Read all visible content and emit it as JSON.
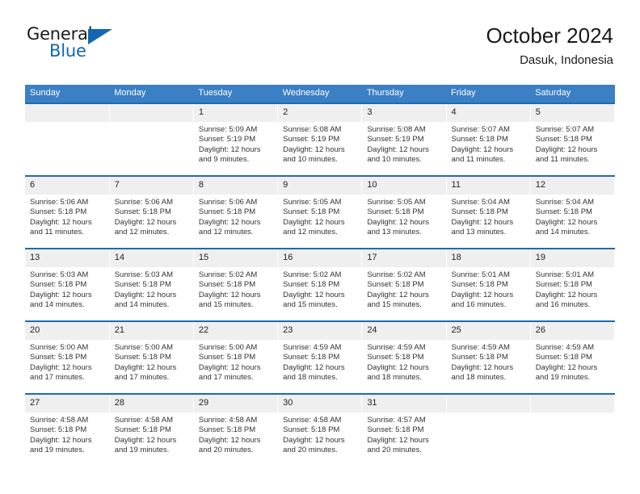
{
  "brand": {
    "line1": "General",
    "line2": "Blue",
    "logo_icon": "triangle-logo-icon",
    "accent_color": "#1267b2"
  },
  "header": {
    "title": "October 2024",
    "subtitle": "Dasuk, Indonesia"
  },
  "calendar": {
    "header_bg": "#3b7fc4",
    "cell_top_border": "#1f6cb0",
    "daynum_bg": "#efefef",
    "weekdays": [
      "Sunday",
      "Monday",
      "Tuesday",
      "Wednesday",
      "Thursday",
      "Friday",
      "Saturday"
    ],
    "weeks": [
      [
        {
          "day": "",
          "sunrise": "",
          "sunset": "",
          "daylight1": "",
          "daylight2": ""
        },
        {
          "day": "",
          "sunrise": "",
          "sunset": "",
          "daylight1": "",
          "daylight2": ""
        },
        {
          "day": "1",
          "sunrise": "Sunrise: 5:09 AM",
          "sunset": "Sunset: 5:19 PM",
          "daylight1": "Daylight: 12 hours",
          "daylight2": "and 9 minutes."
        },
        {
          "day": "2",
          "sunrise": "Sunrise: 5:08 AM",
          "sunset": "Sunset: 5:19 PM",
          "daylight1": "Daylight: 12 hours",
          "daylight2": "and 10 minutes."
        },
        {
          "day": "3",
          "sunrise": "Sunrise: 5:08 AM",
          "sunset": "Sunset: 5:19 PM",
          "daylight1": "Daylight: 12 hours",
          "daylight2": "and 10 minutes."
        },
        {
          "day": "4",
          "sunrise": "Sunrise: 5:07 AM",
          "sunset": "Sunset: 5:18 PM",
          "daylight1": "Daylight: 12 hours",
          "daylight2": "and 11 minutes."
        },
        {
          "day": "5",
          "sunrise": "Sunrise: 5:07 AM",
          "sunset": "Sunset: 5:18 PM",
          "daylight1": "Daylight: 12 hours",
          "daylight2": "and 11 minutes."
        }
      ],
      [
        {
          "day": "6",
          "sunrise": "Sunrise: 5:06 AM",
          "sunset": "Sunset: 5:18 PM",
          "daylight1": "Daylight: 12 hours",
          "daylight2": "and 11 minutes."
        },
        {
          "day": "7",
          "sunrise": "Sunrise: 5:06 AM",
          "sunset": "Sunset: 5:18 PM",
          "daylight1": "Daylight: 12 hours",
          "daylight2": "and 12 minutes."
        },
        {
          "day": "8",
          "sunrise": "Sunrise: 5:06 AM",
          "sunset": "Sunset: 5:18 PM",
          "daylight1": "Daylight: 12 hours",
          "daylight2": "and 12 minutes."
        },
        {
          "day": "9",
          "sunrise": "Sunrise: 5:05 AM",
          "sunset": "Sunset: 5:18 PM",
          "daylight1": "Daylight: 12 hours",
          "daylight2": "and 12 minutes."
        },
        {
          "day": "10",
          "sunrise": "Sunrise: 5:05 AM",
          "sunset": "Sunset: 5:18 PM",
          "daylight1": "Daylight: 12 hours",
          "daylight2": "and 13 minutes."
        },
        {
          "day": "11",
          "sunrise": "Sunrise: 5:04 AM",
          "sunset": "Sunset: 5:18 PM",
          "daylight1": "Daylight: 12 hours",
          "daylight2": "and 13 minutes."
        },
        {
          "day": "12",
          "sunrise": "Sunrise: 5:04 AM",
          "sunset": "Sunset: 5:18 PM",
          "daylight1": "Daylight: 12 hours",
          "daylight2": "and 14 minutes."
        }
      ],
      [
        {
          "day": "13",
          "sunrise": "Sunrise: 5:03 AM",
          "sunset": "Sunset: 5:18 PM",
          "daylight1": "Daylight: 12 hours",
          "daylight2": "and 14 minutes."
        },
        {
          "day": "14",
          "sunrise": "Sunrise: 5:03 AM",
          "sunset": "Sunset: 5:18 PM",
          "daylight1": "Daylight: 12 hours",
          "daylight2": "and 14 minutes."
        },
        {
          "day": "15",
          "sunrise": "Sunrise: 5:02 AM",
          "sunset": "Sunset: 5:18 PM",
          "daylight1": "Daylight: 12 hours",
          "daylight2": "and 15 minutes."
        },
        {
          "day": "16",
          "sunrise": "Sunrise: 5:02 AM",
          "sunset": "Sunset: 5:18 PM",
          "daylight1": "Daylight: 12 hours",
          "daylight2": "and 15 minutes."
        },
        {
          "day": "17",
          "sunrise": "Sunrise: 5:02 AM",
          "sunset": "Sunset: 5:18 PM",
          "daylight1": "Daylight: 12 hours",
          "daylight2": "and 15 minutes."
        },
        {
          "day": "18",
          "sunrise": "Sunrise: 5:01 AM",
          "sunset": "Sunset: 5:18 PM",
          "daylight1": "Daylight: 12 hours",
          "daylight2": "and 16 minutes."
        },
        {
          "day": "19",
          "sunrise": "Sunrise: 5:01 AM",
          "sunset": "Sunset: 5:18 PM",
          "daylight1": "Daylight: 12 hours",
          "daylight2": "and 16 minutes."
        }
      ],
      [
        {
          "day": "20",
          "sunrise": "Sunrise: 5:00 AM",
          "sunset": "Sunset: 5:18 PM",
          "daylight1": "Daylight: 12 hours",
          "daylight2": "and 17 minutes."
        },
        {
          "day": "21",
          "sunrise": "Sunrise: 5:00 AM",
          "sunset": "Sunset: 5:18 PM",
          "daylight1": "Daylight: 12 hours",
          "daylight2": "and 17 minutes."
        },
        {
          "day": "22",
          "sunrise": "Sunrise: 5:00 AM",
          "sunset": "Sunset: 5:18 PM",
          "daylight1": "Daylight: 12 hours",
          "daylight2": "and 17 minutes."
        },
        {
          "day": "23",
          "sunrise": "Sunrise: 4:59 AM",
          "sunset": "Sunset: 5:18 PM",
          "daylight1": "Daylight: 12 hours",
          "daylight2": "and 18 minutes."
        },
        {
          "day": "24",
          "sunrise": "Sunrise: 4:59 AM",
          "sunset": "Sunset: 5:18 PM",
          "daylight1": "Daylight: 12 hours",
          "daylight2": "and 18 minutes."
        },
        {
          "day": "25",
          "sunrise": "Sunrise: 4:59 AM",
          "sunset": "Sunset: 5:18 PM",
          "daylight1": "Daylight: 12 hours",
          "daylight2": "and 18 minutes."
        },
        {
          "day": "26",
          "sunrise": "Sunrise: 4:59 AM",
          "sunset": "Sunset: 5:18 PM",
          "daylight1": "Daylight: 12 hours",
          "daylight2": "and 19 minutes."
        }
      ],
      [
        {
          "day": "27",
          "sunrise": "Sunrise: 4:58 AM",
          "sunset": "Sunset: 5:18 PM",
          "daylight1": "Daylight: 12 hours",
          "daylight2": "and 19 minutes."
        },
        {
          "day": "28",
          "sunrise": "Sunrise: 4:58 AM",
          "sunset": "Sunset: 5:18 PM",
          "daylight1": "Daylight: 12 hours",
          "daylight2": "and 19 minutes."
        },
        {
          "day": "29",
          "sunrise": "Sunrise: 4:58 AM",
          "sunset": "Sunset: 5:18 PM",
          "daylight1": "Daylight: 12 hours",
          "daylight2": "and 20 minutes."
        },
        {
          "day": "30",
          "sunrise": "Sunrise: 4:58 AM",
          "sunset": "Sunset: 5:18 PM",
          "daylight1": "Daylight: 12 hours",
          "daylight2": "and 20 minutes."
        },
        {
          "day": "31",
          "sunrise": "Sunrise: 4:57 AM",
          "sunset": "Sunset: 5:18 PM",
          "daylight1": "Daylight: 12 hours",
          "daylight2": "and 20 minutes."
        },
        {
          "day": "",
          "sunrise": "",
          "sunset": "",
          "daylight1": "",
          "daylight2": ""
        },
        {
          "day": "",
          "sunrise": "",
          "sunset": "",
          "daylight1": "",
          "daylight2": ""
        }
      ]
    ]
  }
}
